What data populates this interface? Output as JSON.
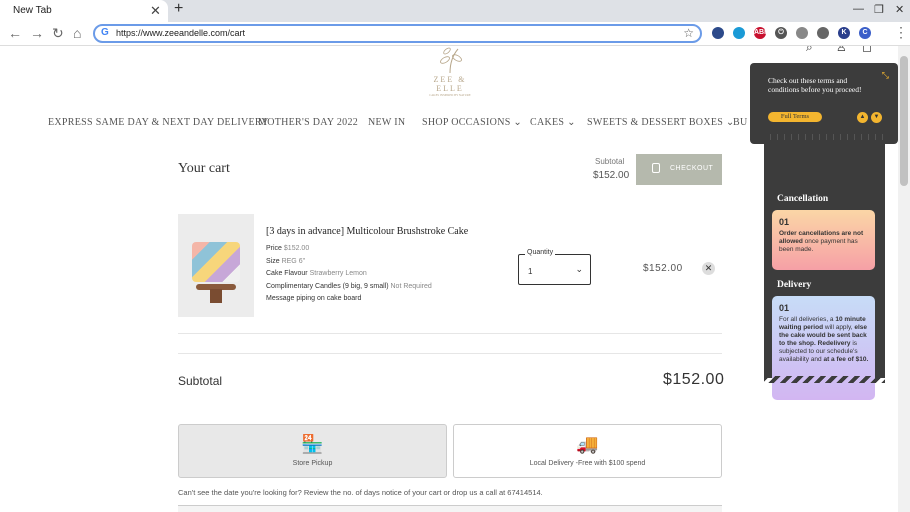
{
  "browser": {
    "tab_title": "New Tab",
    "tab_close": "✕",
    "new_tab": "+",
    "url": "https://www.zeeandelle.com/cart",
    "window_min": "—",
    "window_restore": "❐",
    "window_close": "✕",
    "extensions": [
      {
        "name": "shield-ext",
        "label": "",
        "color": "#2c4a8a"
      },
      {
        "name": "heart-ext",
        "label": "",
        "color": "#1a9ad6"
      },
      {
        "name": "abp-ext",
        "label": "ABP",
        "color": "#c8102e"
      },
      {
        "name": "power-ext",
        "label": "⏻",
        "color": "#555"
      },
      {
        "name": "copy-ext",
        "label": "",
        "color": "#888"
      },
      {
        "name": "camera-ext",
        "label": "",
        "color": "#666"
      },
      {
        "name": "k-ext",
        "label": "K",
        "color": "#2b3f8c"
      },
      {
        "name": "c-ext",
        "label": "C",
        "color": "#3b5fc9"
      }
    ]
  },
  "brand": {
    "name": "ZEE & ELLE",
    "tagline": "CAKES INSPIRED BY NATURE"
  },
  "nav": {
    "items": [
      "EXPRESS SAME DAY & NEXT DAY DELIVERY",
      "MOTHER'S DAY 2022",
      "NEW IN",
      "SHOP OCCASIONS",
      "CAKES",
      "SWEETS & DESSERT BOXES",
      "BU"
    ]
  },
  "cart": {
    "title": "Your cart",
    "subtotal_label": "Subtotal",
    "subtotal_value": "$152.00",
    "checkout_label": "CHECKOUT",
    "item": {
      "name": "[3 days in advance] Multicolour Brushstroke Cake",
      "price_label": "Price",
      "price_value": "$152.00",
      "size_label": "Size",
      "size_value": "REG 6\"",
      "flavour_label": "Cake Flavour",
      "flavour_value": "Strawberry Lemon",
      "candles_label": "Complimentary Candles (9 big, 9 small)",
      "candles_value": "Not Required",
      "message_label": "Message piping on cake board",
      "quantity_label": "Quantity",
      "quantity_value": "1",
      "line_total": "$152.00"
    },
    "subtotal_row_label": "Subtotal",
    "subtotal_row_value": "$152.00",
    "options": [
      {
        "icon": "store-icon",
        "label": "Store Pickup",
        "selected": true
      },
      {
        "icon": "truck-icon",
        "label": "Local Delivery -Free with $100 spend",
        "selected": false
      }
    ],
    "note": "Can't see the date you're looking for? Review the no. of days notice of your cart or drop us a call at 67414514."
  },
  "terms_panel": {
    "text": "Check out these terms and conditions before you proceed!",
    "button_label": "Full Terms",
    "sections": [
      {
        "title": "Cancellation",
        "number": "01",
        "parts": [
          {
            "text": "Order cancellations are not allowed",
            "bold": true
          },
          {
            "text": " once payment has been made.",
            "bold": false
          }
        ],
        "color_from": "#fbd6a6",
        "color_to": "#f6a0a6"
      },
      {
        "title": "Delivery",
        "number": "01",
        "parts": [
          {
            "text": "For all deliveries, a ",
            "bold": false
          },
          {
            "text": "10 minute waiting period",
            "bold": true
          },
          {
            "text": " will apply, ",
            "bold": false
          },
          {
            "text": "else the cake would be sent back to the shop.",
            "bold": true
          },
          {
            "text": " ",
            "bold": false
          },
          {
            "text": "Redelivery",
            "bold": true
          },
          {
            "text": " is subjected to our schedule's availability and ",
            "bold": false
          },
          {
            "text": "at a fee of $10.",
            "bold": true
          }
        ],
        "color_from": "#c7dcf7",
        "color_to": "#d2b6f2"
      }
    ]
  }
}
